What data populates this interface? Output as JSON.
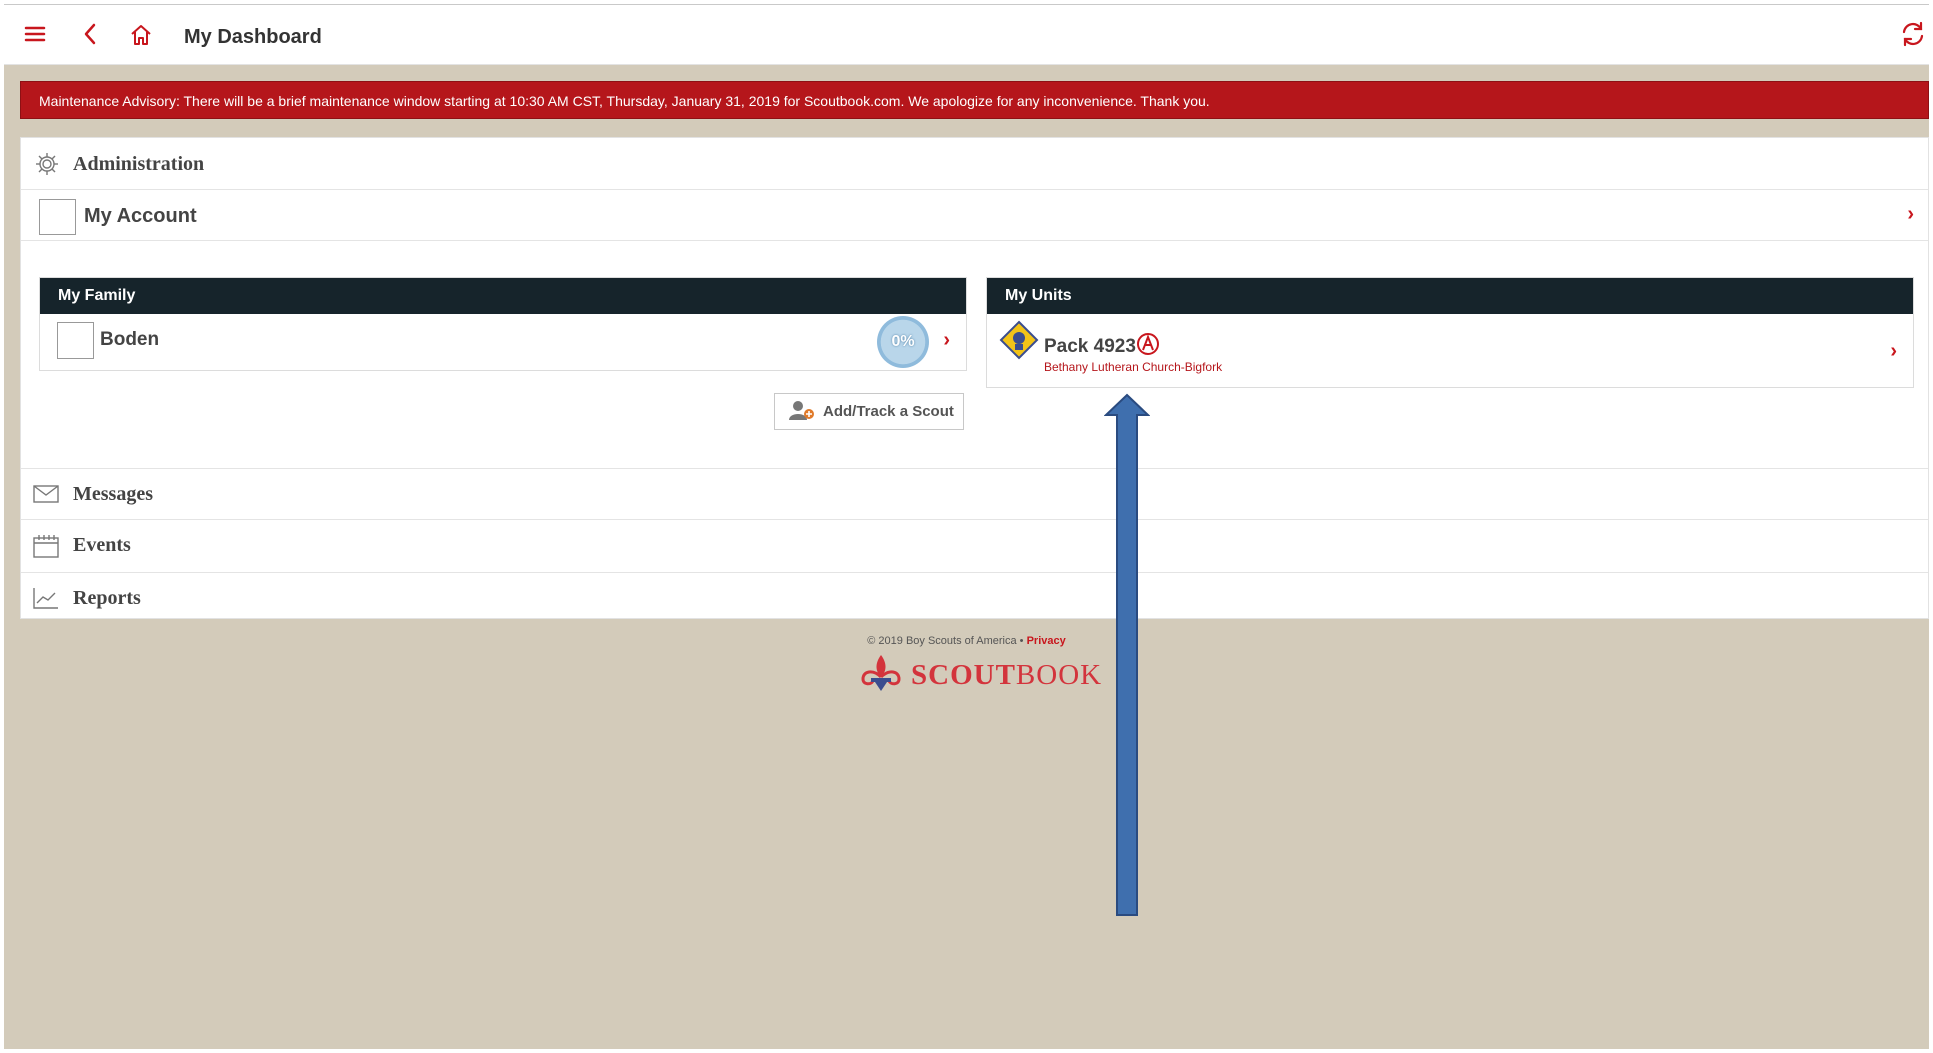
{
  "header": {
    "title": "My Dashboard"
  },
  "advisory": {
    "text": "Maintenance Advisory: There will be a brief maintenance window starting at 10:30 AM CST, Thursday, January 31, 2019 for Scoutbook.com. We apologize for any inconvenience. Thank you."
  },
  "menu": {
    "administration": "Administration",
    "my_account": "My Account",
    "messages": "Messages",
    "events": "Events",
    "reports": "Reports"
  },
  "family": {
    "heading": "My Family",
    "members": [
      {
        "name": "Boden",
        "progress": "0%"
      }
    ],
    "add_button": "Add/Track a Scout"
  },
  "units": {
    "heading": "My Units",
    "items": [
      {
        "name": "Pack 4923",
        "org": "Bethany Lutheran Church-Bigfork"
      }
    ]
  },
  "footer": {
    "copyright": "© 2019 Boy Scouts of America •",
    "privacy": "Privacy",
    "brand_bold": "SCOUT",
    "brand_light": "BOOK"
  },
  "colors": {
    "accent": "#c8161d",
    "advisory_bg": "#b5161b",
    "card_header": "#16242b",
    "page_bg": "#d3cbba",
    "annotation_arrow": "#3f6fae"
  }
}
